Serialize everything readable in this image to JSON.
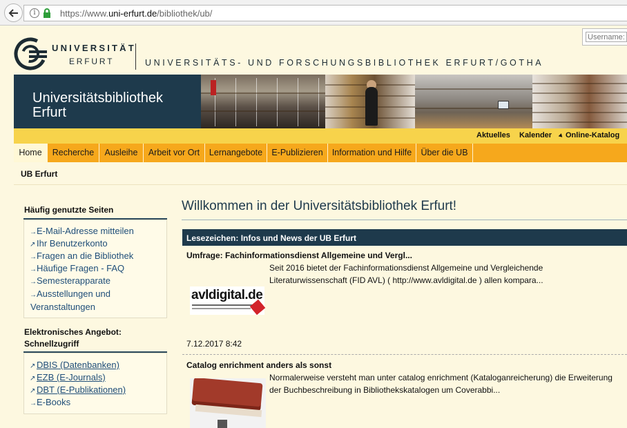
{
  "browser": {
    "url_prefix": "https://www.",
    "url_domain": "uni-erfurt.de",
    "url_path": "/bibliothek/ub/"
  },
  "login": {
    "username_placeholder": "Username:"
  },
  "header": {
    "logo_line1": "UNIVERSITÄT",
    "logo_line2": "ERFURT",
    "title": "UNIVERSITÄTS- UND FORSCHUNGSBIBLIOTHEK ERFURT/GOTHA"
  },
  "banner": {
    "title": "Universitätsbibliothek Erfurt"
  },
  "toplinks": [
    "Aktuelles",
    "Kalender",
    "Online-Katalog"
  ],
  "nav": [
    "Home",
    "Recherche",
    "Ausleihe",
    "Arbeit vor Ort",
    "Lernangebote",
    "E-Publizieren",
    "Information und Hilfe",
    "Über die UB"
  ],
  "breadcrumb": "UB Erfurt",
  "sidebar": {
    "box1_title": "Häufig genutzte Seiten",
    "box1_links": [
      "E-Mail-Adresse mitteilen",
      "Ihr Benutzerkonto",
      "Fragen an die Bibliothek",
      "Häufige Fragen - FAQ",
      "Semesterapparate",
      "Ausstellungen und",
      "Veranstaltungen"
    ],
    "box2_title_line1": "Elektronisches Angebot:",
    "box2_title_line2": "Schnellzugriff",
    "box2_links": [
      "DBIS (Datenbanken)",
      "EZB (E-Journals)",
      "DBT (E-Publikationen)",
      "E-Books"
    ]
  },
  "main": {
    "welcome": "Willkommen in der Universitätsbibliothek Erfurt!",
    "news_header": "Lesezeichen: Infos und News der UB Erfurt",
    "items": [
      {
        "title": "Umfrage: Fachinformationsdienst Allgemeine und Vergl...",
        "text_line1": "Seit 2016 bietet der Fachinformationsdienst Allgemeine und Vergleichende",
        "text_line2": "Literaturwissenschaft (FID AVL) ( http://www.avldigital.de ) allen kompara...",
        "logo_text": "avldigital.de",
        "date": "7.12.2017 8:42"
      },
      {
        "title": "Catalog enrichment anders als sonst",
        "text_line1": "Normalerweise versteht man unter catalog enrichment (Kataloganreicherung) die Erweiterung",
        "text_line2": "der Buchbeschreibung in Bibliothekskatalogen um Coverabbi..."
      }
    ]
  },
  "colors": {
    "navy": "#1e3a4c",
    "orange_nav": "#f6a81c",
    "yellow_bar": "#f7d34b",
    "page_bg": "#fdf8e0",
    "link": "#1f4e79"
  }
}
